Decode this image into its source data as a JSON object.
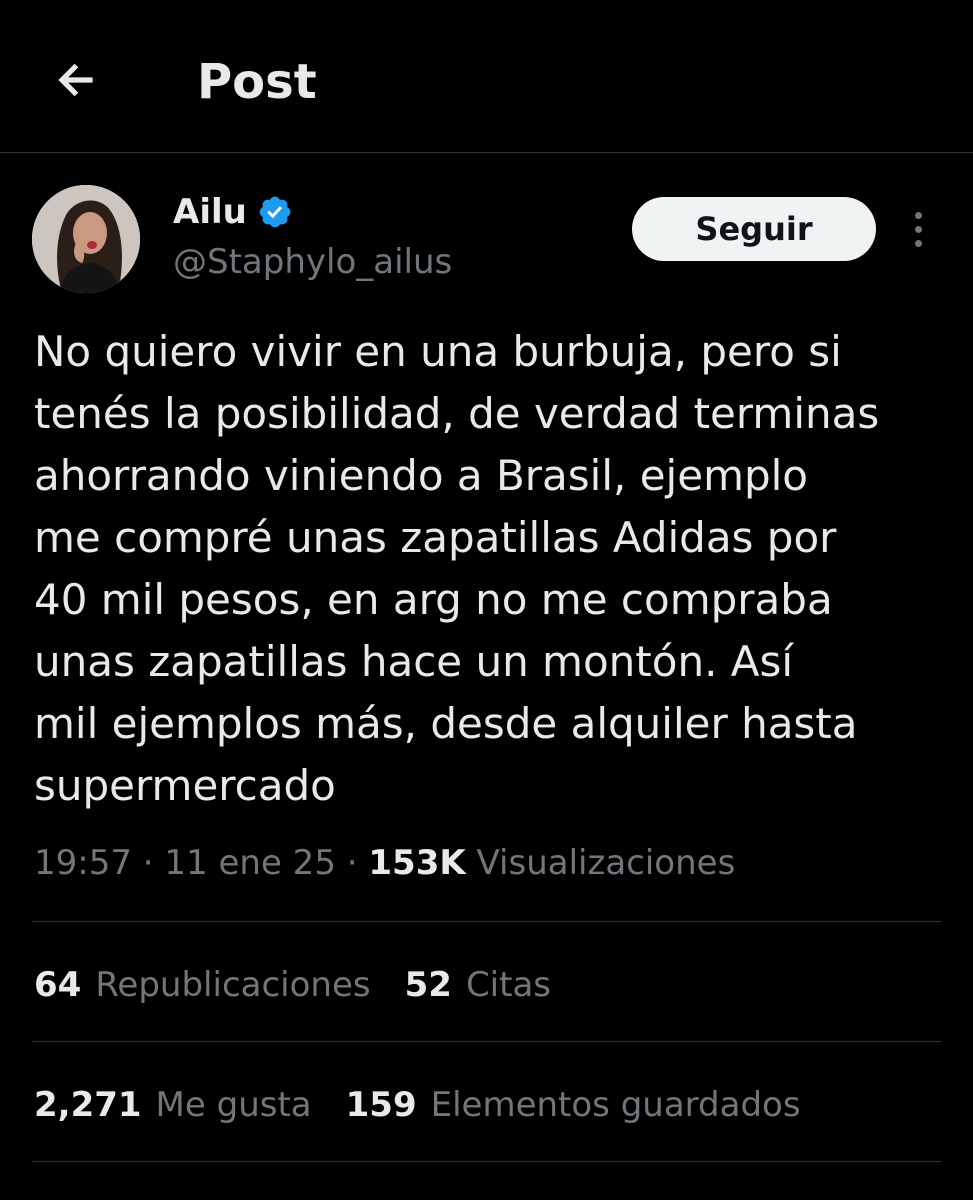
{
  "header": {
    "back_icon": "arrow-left-icon",
    "title": "Post"
  },
  "author": {
    "name": "Ailu",
    "handle": "@Staphylo_ailus",
    "verified_icon": "verified-badge-icon",
    "verified_color": "#1d9bf0"
  },
  "follow_button": {
    "label": "Seguir"
  },
  "more_icon": "more-vertical-icon",
  "tweet": {
    "text": "No quiero vivir en una burbuja, pero si\ntenés la posibilidad, de verdad terminas\nahorrando viniendo a Brasil, ejemplo\nme compré unas zapatillas Adidas por\n40 mil pesos, en arg no me compraba\nunas zapatillas hace un montón. Así\nmil ejemplos más, desde alquiler hasta\nsupermercado"
  },
  "meta": {
    "time": "19:57",
    "separator": " · ",
    "date": "11 ene 25",
    "views_count": "153K",
    "views_label": "Visualizaciones"
  },
  "stats": {
    "row1": [
      {
        "count": "64",
        "label": "Republicaciones"
      },
      {
        "count": "52",
        "label": "Citas"
      }
    ],
    "row2": [
      {
        "count": "2,271",
        "label": "Me gusta"
      },
      {
        "count": "159",
        "label": "Elementos guardados"
      }
    ]
  },
  "colors": {
    "background": "#000000",
    "text_primary": "#e7e9ea",
    "text_secondary": "#71767b",
    "divider": "#2f3336",
    "button_bg": "#eff3f4"
  }
}
